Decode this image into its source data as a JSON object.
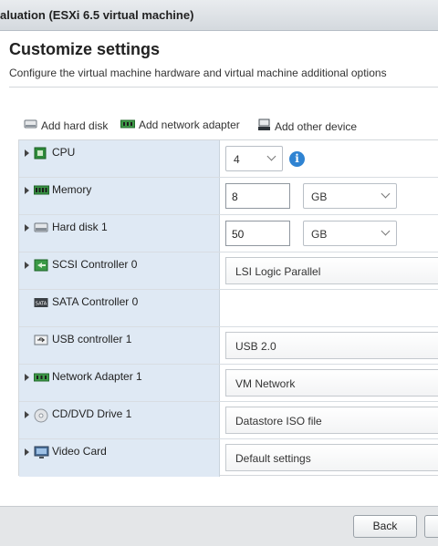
{
  "window": {
    "title": "aluation (ESXi 6.5 virtual machine)"
  },
  "header": {
    "title": "Customize settings",
    "subtitle": "Configure the virtual machine hardware and virtual machine additional options"
  },
  "toolbar": {
    "add_hard_disk": "Add hard disk",
    "add_network_adapter": "Add network adapter",
    "add_other_device": "Add other device"
  },
  "hardware": {
    "cpu": {
      "label": "CPU",
      "value": "4"
    },
    "memory": {
      "label": "Memory",
      "value": "8",
      "unit": "GB"
    },
    "hard_disk": {
      "label": "Hard disk 1",
      "value": "50",
      "unit": "GB"
    },
    "scsi": {
      "label": "SCSI Controller 0",
      "value": "LSI Logic Parallel"
    },
    "sata": {
      "label": "SATA Controller 0"
    },
    "usb": {
      "label": "USB controller 1",
      "value": "USB 2.0"
    },
    "network": {
      "label": "Network Adapter 1",
      "value": "VM Network"
    },
    "cdrom": {
      "label": "CD/DVD Drive 1",
      "value": "Datastore ISO file"
    },
    "video": {
      "label": "Video Card",
      "value": "Default settings"
    }
  },
  "footer": {
    "back": "Back"
  },
  "colors": {
    "accent": "#2f83d2",
    "row_label_bg": "#dfe9f4",
    "chip_green": "#2e8b3a"
  }
}
